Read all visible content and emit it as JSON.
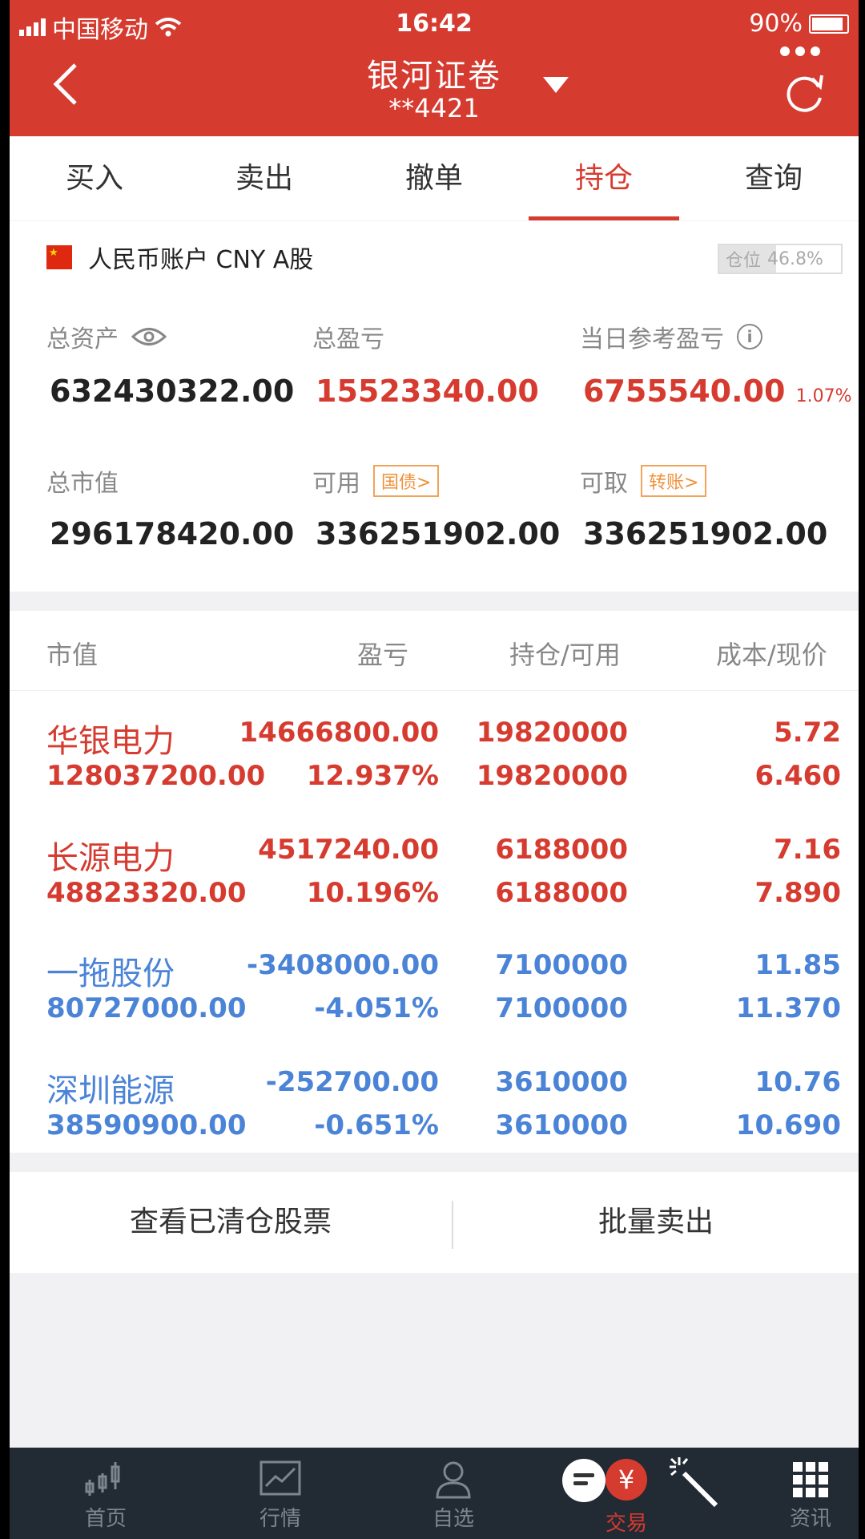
{
  "status_bar": {
    "carrier": "中国移动",
    "time": "16:42",
    "battery": "90%"
  },
  "header": {
    "title": "银河证卷",
    "account_suffix": "**4421"
  },
  "tabs": [
    {
      "label": "买入"
    },
    {
      "label": "卖出"
    },
    {
      "label": "撤单"
    },
    {
      "label": "持仓",
      "active": true
    },
    {
      "label": "查询"
    }
  ],
  "account": {
    "label": "人民币账户 CNY A股",
    "position_label": "仓位",
    "position_value": "46.8%",
    "position_fraction": 0.468
  },
  "metrics": {
    "total_assets_label": "总资产",
    "total_assets": "632430322.00",
    "total_pl_label": "总盈亏",
    "total_pl": "15523340.00",
    "daily_pl_label": "当日参考盈亏",
    "daily_pl": "6755540.00",
    "daily_pl_pct": "1.07%",
    "market_value_label": "总市值",
    "market_value": "296178420.00",
    "available_label": "可用",
    "available_tag": "国债>",
    "available": "336251902.00",
    "withdrawable_label": "可取",
    "withdrawable_tag": "转账>",
    "withdrawable": "336251902.00"
  },
  "holdings": {
    "headers": {
      "market_value": "市值",
      "pl": "盈亏",
      "position": "持仓/可用",
      "cost_price": "成本/现价"
    },
    "rows": [
      {
        "name": "华银电力",
        "market_value": "128037200.00",
        "pl": "14666800.00",
        "pl_pct": "12.937%",
        "position": "19820000",
        "available": "19820000",
        "cost": "5.72",
        "price": "6.460",
        "color": "#d63b30"
      },
      {
        "name": "长源电力",
        "market_value": "48823320.00",
        "pl": "4517240.00",
        "pl_pct": "10.196%",
        "position": "6188000",
        "available": "6188000",
        "cost": "7.16",
        "price": "7.890",
        "color": "#d63b30"
      },
      {
        "name": "一拖股份",
        "market_value": "80727000.00",
        "pl": "-3408000.00",
        "pl_pct": "-4.051%",
        "position": "7100000",
        "available": "7100000",
        "cost": "11.85",
        "price": "11.370",
        "color": "#4b84d7"
      },
      {
        "name": "深圳能源",
        "market_value": "38590900.00",
        "pl": "-252700.00",
        "pl_pct": "-0.651%",
        "position": "3610000",
        "available": "3610000",
        "cost": "10.76",
        "price": "10.690",
        "color": "#4b84d7"
      }
    ]
  },
  "actions": {
    "cleared": "查看已清仓股票",
    "batch_sell": "批量卖出"
  },
  "tabbar": [
    {
      "label": "首页",
      "icon": "candlestick-icon"
    },
    {
      "label": "行情",
      "icon": "chart-icon"
    },
    {
      "label": "自选",
      "icon": "person-icon"
    },
    {
      "label": "交易",
      "icon": "yen-icon",
      "active": true
    },
    {
      "label": "资讯",
      "icon": "grid-icon"
    }
  ]
}
